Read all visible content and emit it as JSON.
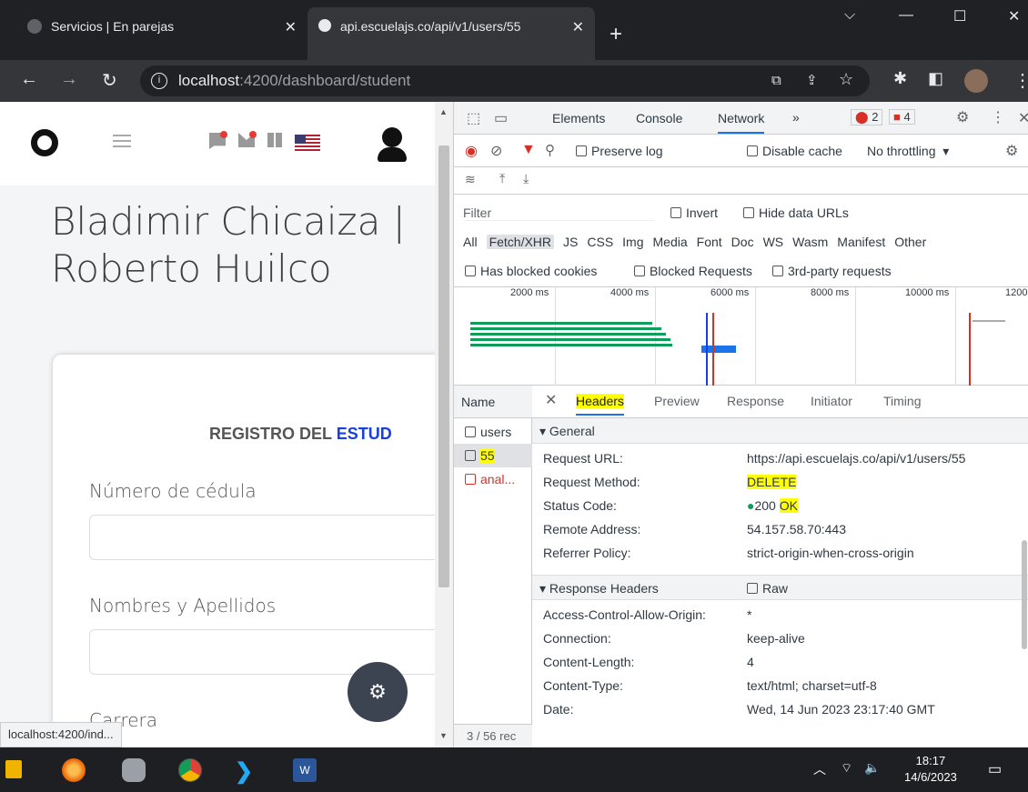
{
  "browser": {
    "tabs": [
      {
        "title": "Servicios | En parejas",
        "active": false
      },
      {
        "title": "api.escuelajs.co/api/v1/users/55",
        "active": true
      }
    ],
    "new_tab": "+",
    "close": "✕",
    "address": {
      "host": "localhost",
      "rest": ":4200/dashboard/student"
    },
    "status_url": "localhost:4200/ind..."
  },
  "page": {
    "student_name": "Bladimir Chicaiza | Roberto Huilco",
    "form_title_prefix": "REGISTRO DEL ",
    "form_title_accent": "ESTUD",
    "fields": [
      {
        "label": "Número de cédula"
      },
      {
        "label": "Nombres y Apellidos"
      },
      {
        "label": "Carrera"
      }
    ]
  },
  "devtools": {
    "panels": [
      "Elements",
      "Console",
      "Network",
      "»"
    ],
    "active_panel": "Network",
    "errors": "2",
    "warnings": "4",
    "toolbar": {
      "preserve_log": "Preserve log",
      "disable_cache": "Disable cache",
      "throttling": "No throttling"
    },
    "filter": {
      "placeholder": "Filter",
      "invert": "Invert",
      "hide_data_urls": "Hide data URLs"
    },
    "types": [
      "All",
      "Fetch/XHR",
      "JS",
      "CSS",
      "Img",
      "Media",
      "Font",
      "Doc",
      "WS",
      "Wasm",
      "Manifest",
      "Other"
    ],
    "active_type": "Fetch/XHR",
    "extra_filters": [
      "Has blocked cookies",
      "Blocked Requests",
      "3rd-party requests"
    ],
    "timeline_ticks": [
      "2000 ms",
      "4000 ms",
      "6000 ms",
      "8000 ms",
      "10000 ms",
      "1200"
    ],
    "name_header": "Name",
    "requests": [
      {
        "name": "users",
        "error": false,
        "selected": false
      },
      {
        "name": "55",
        "error": false,
        "selected": true
      },
      {
        "name": "anal...",
        "error": true,
        "selected": false
      }
    ],
    "request_count": "3 / 56 rec",
    "detail_tabs": [
      "Headers",
      "Preview",
      "Response",
      "Initiator",
      "Timing"
    ],
    "active_detail_tab": "Headers",
    "general_title": "General",
    "general": [
      {
        "key": "Request URL:",
        "value": "https://api.escuelajs.co/api/v1/users/55"
      },
      {
        "key": "Request Method:",
        "value": "DELETE"
      },
      {
        "key": "Status Code:",
        "value": "200",
        "value_extra": "OK"
      },
      {
        "key": "Remote Address:",
        "value": "54.157.58.70:443"
      },
      {
        "key": "Referrer Policy:",
        "value": "strict-origin-when-cross-origin"
      }
    ],
    "response_headers_title": "Response Headers",
    "raw_label": "Raw",
    "response_headers": [
      {
        "key": "Access-Control-Allow-Origin:",
        "value": "*"
      },
      {
        "key": "Connection:",
        "value": "keep-alive"
      },
      {
        "key": "Content-Length:",
        "value": "4"
      },
      {
        "key": "Content-Type:",
        "value": "text/html; charset=utf-8"
      },
      {
        "key": "Date:",
        "value": "Wed, 14 Jun 2023 23:17:40 GMT"
      }
    ]
  },
  "taskbar": {
    "time": "18:17",
    "date": "14/6/2023"
  }
}
